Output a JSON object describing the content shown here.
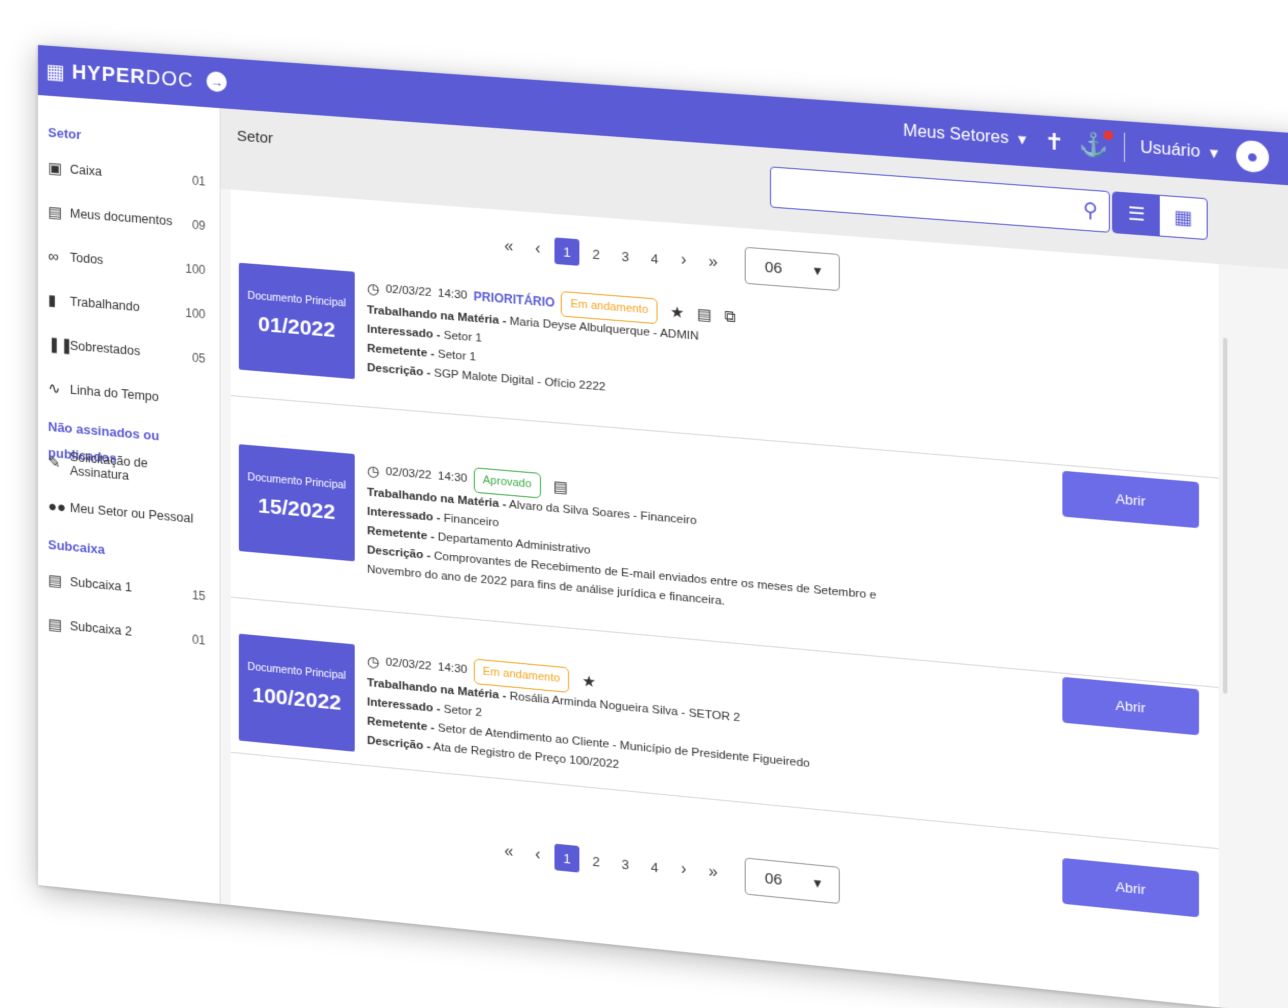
{
  "brand": {
    "bold": "HYPER",
    "light": "DOC"
  },
  "topbar": {
    "sectors": "Meus Setores",
    "user": "Usuário"
  },
  "sidebar": {
    "section_setor": "Setor",
    "setor_items": [
      {
        "label": "Caixa",
        "count": "01",
        "icon": "inbox-icon"
      },
      {
        "label": "Meus documentos",
        "count": "09",
        "icon": "document-icon"
      },
      {
        "label": "Todos",
        "count": "100",
        "icon": "infinity-icon"
      },
      {
        "label": "Trabalhando",
        "count": "100",
        "icon": "briefcase-icon"
      },
      {
        "label": "Sobrestados",
        "count": "05",
        "icon": "pause-icon"
      },
      {
        "label": "Linha do Tempo",
        "count": "",
        "icon": "timeline-icon"
      }
    ],
    "section_unsigned": "Não assinados ou publicados",
    "unsigned_items": [
      {
        "label": "Solicitação de Assinatura",
        "icon": "signature-icon"
      },
      {
        "label": "Meu Setor ou Pessoal",
        "icon": "people-icon"
      }
    ],
    "section_subcaixa": "Subcaixa",
    "subcaixa_items": [
      {
        "label": "Subcaixa 1",
        "count": "15",
        "icon": "subinbox-icon"
      },
      {
        "label": "Subcaixa 2",
        "count": "01",
        "icon": "subinbox-icon"
      }
    ]
  },
  "main": {
    "title": "Setor",
    "search": {
      "placeholder": "",
      "value": ""
    }
  },
  "pagination": {
    "pages": [
      "1",
      "2",
      "3",
      "4"
    ],
    "current": "1",
    "per_page": "06"
  },
  "documents": [
    {
      "doc_label": "Documento Principal",
      "number": "01/2022",
      "date": "02/03/22",
      "time": "14:30",
      "priority": "PRIORITÁRIO",
      "status": "Em andamento",
      "status_color": "#f5a623",
      "actions": [
        "star-icon",
        "note-icon",
        "share-icon"
      ],
      "fields": [
        {
          "label": "Trabalhando na Matéria -",
          "value": "Maria Deyse Albulquerque - ADMIN"
        },
        {
          "label": "Interessado -",
          "value": "Setor 1"
        },
        {
          "label": "Remetente -",
          "value": "Setor 1"
        },
        {
          "label": "Descrição -",
          "value": "SGP Malote Digital - Ofício 2222"
        }
      ],
      "open_label": "Abrir"
    },
    {
      "doc_label": "Documento Principal",
      "number": "15/2022",
      "date": "02/03/22",
      "time": "14:30",
      "priority": "",
      "status": "Aprovado",
      "status_color": "#3fae49",
      "actions": [
        "note-icon"
      ],
      "fields": [
        {
          "label": "Trabalhando na Matéria -",
          "value": "Alvaro da Silva Soares - Financeiro"
        },
        {
          "label": "Interessado -",
          "value": "Financeiro"
        },
        {
          "label": "Remetente -",
          "value": "Departamento Administrativo"
        },
        {
          "label": "Descrição -",
          "value": "Comprovantes de Recebimento de E-mail enviados entre os meses de Setembro e Novembro do ano de 2022 para fins de análise jurídica e financeira."
        }
      ],
      "open_label": "Abrir"
    },
    {
      "doc_label": "Documento Principal",
      "number": "100/2022",
      "date": "02/03/22",
      "time": "14:30",
      "priority": "",
      "status": "Em andamento",
      "status_color": "#f5a623",
      "actions": [
        "star-icon"
      ],
      "fields": [
        {
          "label": "Trabalhando na Matéria -",
          "value": "Rosália Arminda Nogueira Silva - SETOR 2"
        },
        {
          "label": "Interessado -",
          "value": "Setor 2"
        },
        {
          "label": "Remetente -",
          "value": "Setor de Atendimento ao Cliente - Município de Presidente Figueiredo"
        },
        {
          "label": "Descrição -",
          "value": "Ata de Registro de Preço 100/2022"
        }
      ],
      "open_label": "Abrir"
    }
  ],
  "colors": {
    "primary": "#5b5bd6",
    "button": "#6c6ce8",
    "orange": "#f5a623",
    "green": "#3fae49",
    "notification": "#e53935"
  }
}
